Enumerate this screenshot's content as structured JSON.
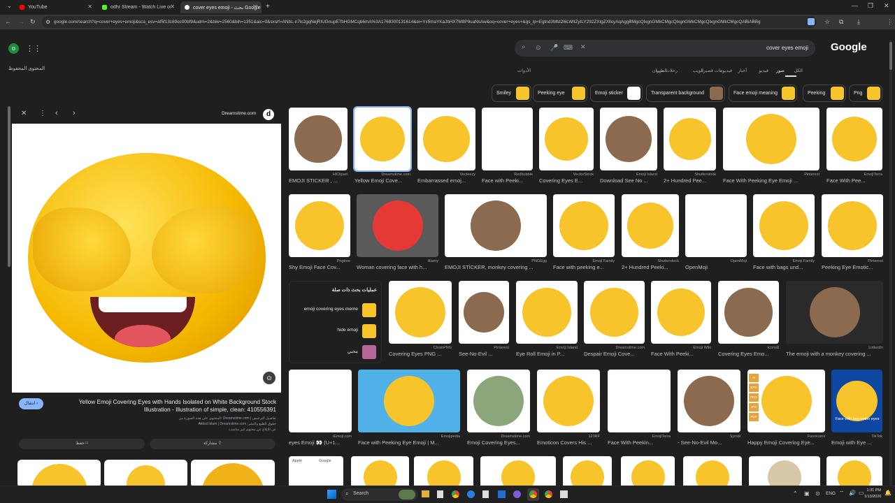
{
  "tabs": [
    {
      "title": "YouTube",
      "color": "#ff0000"
    },
    {
      "title": "odhr Stream - Watch Live on Ki",
      "color": "#53fc18"
    },
    {
      "title": "cover eyes emoji - بحث Google",
      "color": "#4285f4"
    }
  ],
  "address": "google.com/search?q=cover+eyes+emoji&sca_esv=af5f13c89ec90bf9&udm=2&biw=2560&bih=1351&aic=0&sxsrf=ANbL-n7lc2gqNejRIUGnupE7bHGMCqb6mA%3A1768300131614&ei=Yx5maYKaJbHX7M8P9uaNsAw&oq=cover+eyes+&gs_lp=Egtnd3Mtd2l6LWltZyILY292ZXIgZXllcyAqAggBMgcQlxgnGMkCMgcQlxgnGMkCMgcQlxgnGMkCMgcQABiABBg",
  "search": {
    "query": "cover eyes emoji",
    "logo": "Google"
  },
  "saved_label": "المحتوى المحفوظ",
  "filters": [
    "الكل",
    "صور",
    "فيديو",
    "أخبار",
    "فيديوهات قصيرة",
    "الويب",
    "رحلات طيران",
    "المزيد"
  ],
  "tools_label": "الأدوات",
  "chips": [
    {
      "label": "Smiley"
    },
    {
      "label": "Peeking eye"
    },
    {
      "label": "Emoji sticker"
    },
    {
      "label": "Transparent background"
    },
    {
      "label": "Face emoji meaning"
    },
    {
      "label": "Peeking"
    },
    {
      "label": "Png"
    }
  ],
  "panel": {
    "source": "Dreamstime.com",
    "title": "Yellow Emoji Covering Eyes with Hands Isolated on White Background Stock Illustration - Illustration of simple, clean: 410556391",
    "visit": "انتقال",
    "note1": "المحتوى على هذه الصورة من: Dreamstime.com | تفاصيل الترخيص",
    "note2": "Akikul Islam | Dreamstime.com :حقوق الطبع والنشر",
    "note3": "عن الإبلاغ عن محتوى غير مناسب",
    "save": "حفظ",
    "share": "مشاركة"
  },
  "row1": [
    {
      "src": "HiClipart",
      "cap": "EMOJI STICKER , ..."
    },
    {
      "src": "Dreamstime.com",
      "cap": "Yellow Emoji Cove..."
    },
    {
      "src": "Vecteezy",
      "cap": "Embarrassed emoj..."
    },
    {
      "src": "Redbubble",
      "cap": "Face with Peeki..."
    },
    {
      "src": "VectorStock",
      "cap": "Covering Eyes E..."
    },
    {
      "src": "Emoji Island",
      "cap": "Download See No ..."
    },
    {
      "src": "Shutterstock",
      "cap": "2+ Hundred Pee..."
    },
    {
      "src": "Pinterest",
      "cap": "Face With Peeking Eye Emoji ..."
    },
    {
      "src": "EmojiTerra",
      "cap": "Face With Pee..."
    }
  ],
  "row2": [
    {
      "src": "Pngtree",
      "cap": "Shy Emoji Face Cov..."
    },
    {
      "src": "Alamy",
      "cap": "Woman covering face with h..."
    },
    {
      "src": "PNGEgg",
      "cap": "EMOJI STICKER, monkey covering ..."
    },
    {
      "src": "Emoji Family",
      "cap": "Face with peeking e..."
    },
    {
      "src": "Shutterstock",
      "cap": "2+ Hundred Peeki..."
    },
    {
      "src": "OpenMoji",
      "cap": "OpenMoji"
    },
    {
      "src": "Emoji Family",
      "cap": "Face with bags und..."
    },
    {
      "src": "Pinterest",
      "cap": "Peeking Eye Emotic..."
    }
  ],
  "related": {
    "title": "عمليات بحث ذات صلة",
    "items": [
      "emoji covering eyes meme",
      "hide emoji",
      "مخبي"
    ]
  },
  "row3": [
    {
      "src": "CleanPNG",
      "cap": "Covering Eyes PNG ..."
    },
    {
      "src": "Pinterest",
      "cap": "See-No-Evil ..."
    },
    {
      "src": "Emoji Island",
      "cap": "Eye Roll Emoji in P..."
    },
    {
      "src": "Dreamstime.com",
      "cap": "Despair Emoji Cove..."
    },
    {
      "src": "Emoji Wiki",
      "cap": "Face With Peeki..."
    },
    {
      "src": "Icons8",
      "cap": "Covering Eyes Emo..."
    },
    {
      "src": "LinkedIn",
      "cap": "The emoji with a monkey covering ..."
    }
  ],
  "row4": [
    {
      "src": "iEmoji.com",
      "cap": "eyes Emoji 👀 (U+1..."
    },
    {
      "src": "Emojipedia",
      "cap": "Face with Peeking Eye Emoji | M..."
    },
    {
      "src": "Dreamstime.com",
      "cap": "Emoji Covering Eyes..."
    },
    {
      "src": "123RF",
      "cap": "Emoticon Covers His ..."
    },
    {
      "src": "EmojiTerra",
      "cap": "Face With Peekin..."
    },
    {
      "src": "Symbl",
      "cap": "- See-No-Evil Mo..."
    },
    {
      "src": "Funnicons",
      "cap": "Happy Emoji Covering Eye..."
    },
    {
      "src": "TikTok",
      "cap": "Emoji with Eye ..."
    }
  ],
  "row5_labels": [
    "Apple",
    "Google"
  ],
  "overlay_caption": "Face with bag under eyes",
  "png_badges": [
    "AI",
    "EPS",
    "PNG",
    "JPG",
    "PDF"
  ],
  "taskbar": {
    "search": "Search",
    "lang": "ENG",
    "time": "1:31 PM",
    "date": "1/13/2026"
  },
  "colors": {
    "accent": "#8ab4f8",
    "emoji": "#f7c52b",
    "monkey": "#8b6a4f"
  }
}
